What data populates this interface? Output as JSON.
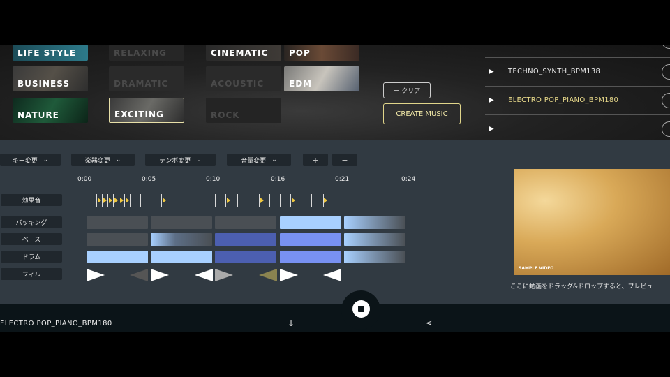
{
  "genres": [
    {
      "label": "LIFE STYLE",
      "state": "active"
    },
    {
      "label": "RELAXING",
      "state": "dim"
    },
    {
      "label": "CINEMATIC",
      "state": "active"
    },
    {
      "label": "POP",
      "state": "active"
    },
    {
      "label": "BUSINESS",
      "state": "active"
    },
    {
      "label": "DRAMATIC",
      "state": "dim"
    },
    {
      "label": "ACOUSTIC",
      "state": "dim"
    },
    {
      "label": "EDM",
      "state": "active"
    },
    {
      "label": "NATURE",
      "state": "active"
    },
    {
      "label": "EXCITING",
      "state": "selected"
    },
    {
      "label": "ROCK",
      "state": "dim"
    }
  ],
  "actions": {
    "clear": "ー クリア",
    "create": "CREATE MUSIC"
  },
  "tracks": [
    {
      "name": "TECHNO_SYNTH_BPM138",
      "active": false
    },
    {
      "name": "ELECTRO POP_PIANO_BPM180",
      "active": true
    }
  ],
  "controls": {
    "key": "キー変更",
    "instrument": "楽器変更",
    "tempo": "テンポ変更",
    "volume": "音量変更",
    "plus": "+",
    "minus": "−"
  },
  "timeline": [
    "0:00",
    "0:05",
    "0:10",
    "0:16",
    "0:21",
    "0:24"
  ],
  "rows": {
    "sfx": "効果音",
    "backing": "バッキング",
    "bass": "ベース",
    "drums": "ドラム",
    "fill": "フィル"
  },
  "video": {
    "badge": "SAMPLE VIDEO",
    "hint": "ここに動画をドラッグ&ドロップすると、プレビュー"
  },
  "player": {
    "now_playing": "ELECTRO POP_PIANO_BPM180"
  },
  "icons": {
    "download": "download-icon",
    "share": "share-icon",
    "stop": "stop-icon"
  }
}
